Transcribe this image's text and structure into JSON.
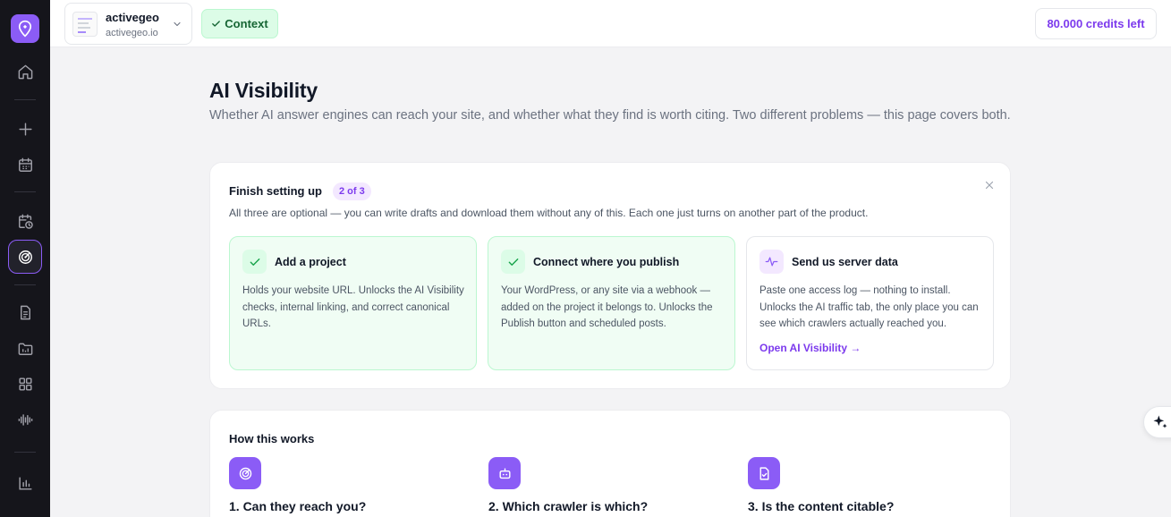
{
  "sidebar": {
    "items": [
      {
        "name": "home-icon"
      },
      {
        "name": "plus-icon"
      },
      {
        "name": "calendar-icon"
      },
      {
        "name": "clock-calendar-icon"
      },
      {
        "name": "radar-icon",
        "active": true
      },
      {
        "name": "document-icon"
      },
      {
        "name": "folder-icon"
      },
      {
        "name": "grid-icon"
      },
      {
        "name": "audio-waveform-icon"
      },
      {
        "name": "bar-chart-icon"
      }
    ]
  },
  "topbar": {
    "project": {
      "name": "activegeo",
      "url": "activegeo.io"
    },
    "context_label": "Context",
    "credits_label": "80.000 credits left"
  },
  "page": {
    "title": "AI Visibility",
    "subtitle": "Whether AI answer engines can reach your site, and whether what they find is worth citing. Two different problems — this page covers both."
  },
  "setup": {
    "title": "Finish setting up",
    "progress": "2 of 3",
    "description": "All three are optional — you can write drafts and download them without any of this. Each one just turns on another part of the product.",
    "tasks": [
      {
        "title": "Add a project",
        "description": "Holds your website URL. Unlocks the AI Visibility checks, internal linking, and correct canonical URLs.",
        "status": "done"
      },
      {
        "title": "Connect where you publish",
        "description": "Your WordPress, or any site via a webhook — added on the project it belongs to. Unlocks the Publish button and scheduled posts.",
        "status": "done"
      },
      {
        "title": "Send us server data",
        "description": "Paste one access log — nothing to install. Unlocks the AI traffic tab, the only place you can see which crawlers actually reached you.",
        "status": "todo",
        "link": "Open AI Visibility →"
      }
    ]
  },
  "how": {
    "title": "How this works",
    "steps": [
      {
        "title": "1. Can they reach you?",
        "icon": "radar-icon"
      },
      {
        "title": "2. Which crawler is which?",
        "icon": "robot-icon"
      },
      {
        "title": "3. Is the content citable?",
        "icon": "document-check-icon"
      }
    ]
  },
  "colors": {
    "accent": "#8b5cf6",
    "success_bg": "#f0fdf4",
    "sidebar_bg": "#15151b"
  }
}
